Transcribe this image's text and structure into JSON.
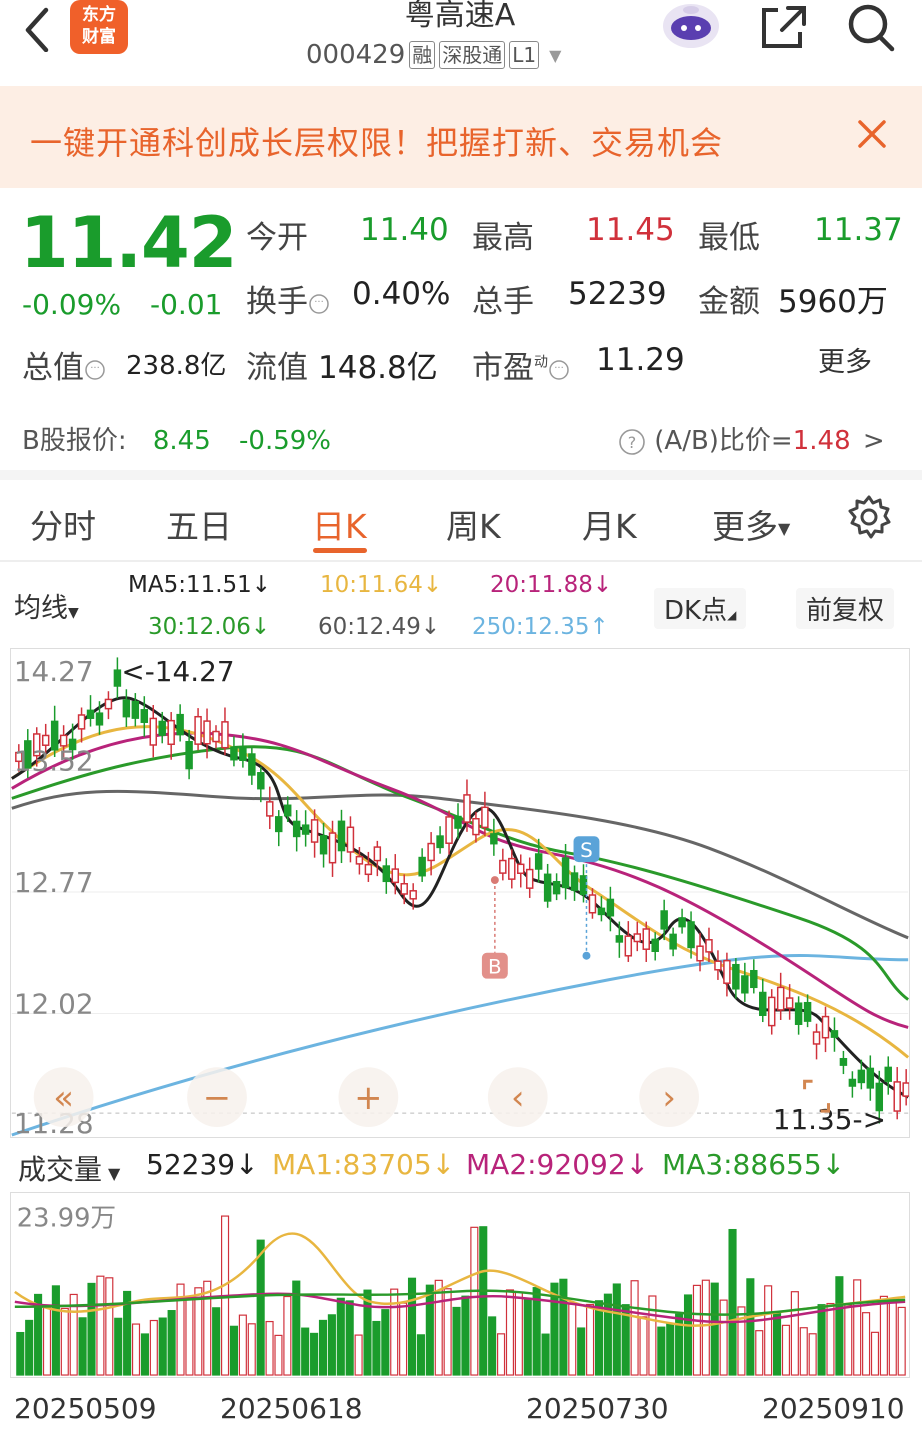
{
  "header": {
    "logo_line1": "东方",
    "logo_line2": "财富",
    "stock_name": "粤高速A",
    "stock_code": "000429",
    "tags": [
      "融",
      "深股通",
      "L1"
    ]
  },
  "banner": {
    "text": "一键开通科创成长层权限！把握打新、交易机会"
  },
  "quote": {
    "price": "11.42",
    "change_pct": "-0.09%",
    "change_abs": "-0.01",
    "open_label": "今开",
    "open": "11.40",
    "high_label": "最高",
    "high": "11.45",
    "low_label": "最低",
    "low": "11.37",
    "turnover_label": "换手",
    "turnover": "0.40%",
    "volume_label": "总手",
    "volume": "52239",
    "amount_label": "金额",
    "amount": "5960万",
    "mktcap_label": "总值",
    "mktcap": "238.8亿",
    "float_label": "流值",
    "float_cap": "148.8亿",
    "pe_label": "市盈",
    "pe_sup": "动",
    "pe": "11.29",
    "more": "更多",
    "b_label": "B股报价:",
    "b_price": "8.45",
    "b_change": "-0.59%",
    "ab_label": "(A/B)比价=",
    "ab_value": "1.48",
    "ab_arrow": ">"
  },
  "tabs": [
    "分时",
    "五日",
    "日K",
    "周K",
    "月K",
    "更多"
  ],
  "ma_legend": {
    "button": "均线",
    "ma5": "MA5:11.51↓",
    "ma10": "10:11.64↓",
    "ma20": "20:11.88↓",
    "ma30": "30:12.06↓",
    "ma60": "60:12.49↓",
    "ma250": "250:12.35↑",
    "dk": "DK点",
    "fq": "前复权"
  },
  "colors": {
    "up": "#d0313b",
    "down": "#1a9c2c",
    "ma5": "#222222",
    "ma10": "#e8b640",
    "ma20": "#b8237a",
    "ma30": "#2a9a2a",
    "ma60": "#666666",
    "ma250": "#6cb4e0"
  },
  "kline": {
    "y_labels": [
      "14.27",
      "13.52",
      "12.77",
      "12.02",
      "11.28"
    ],
    "max_marker": "<-14.27",
    "last_marker": "11.35->",
    "signal_s": "S",
    "signal_b": "B",
    "nav": [
      "«",
      "−",
      "+",
      "‹",
      "›"
    ]
  },
  "volume": {
    "label": "成交量",
    "value": "52239↓",
    "ma1": "MA1:83705↓",
    "ma2": "MA2:92092↓",
    "ma3": "MA3:88655↓",
    "max_label": "23.99万"
  },
  "dates": [
    "20250509",
    "20250618",
    "20250730",
    "20250910"
  ]
}
